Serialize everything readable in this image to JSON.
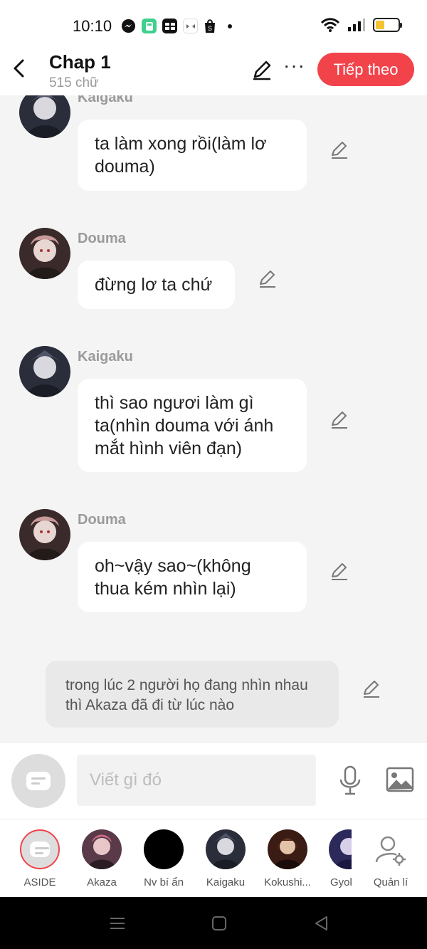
{
  "status_bar": {
    "time": "10:10",
    "app_icons": [
      "messenger-icon",
      "calculator-icon",
      "baomoi-icon",
      "game-icon",
      "shopee-icon"
    ]
  },
  "header": {
    "title": "Chap 1",
    "subtitle": "515 chữ",
    "next_label": "Tiếp theo"
  },
  "messages": [
    {
      "sender": "Kaigaku",
      "text": "ta làm xong rồi(làm lơ douma)"
    },
    {
      "sender": "Douma",
      "text": "đừng lơ ta chứ"
    },
    {
      "sender": "Kaigaku",
      "text": "thì sao ngươi làm gì ta(nhìn douma với ánh mắt hình viên đạn)"
    },
    {
      "sender": "Douma",
      "text": "oh~vậy sao~(không thua kém nhìn lại)"
    }
  ],
  "narration": "trong lúc 2 người họ đang nhìn nhau thì Akaza đã đi từ lúc nào",
  "composer": {
    "placeholder": "Viết gì đó"
  },
  "characters": [
    {
      "label": "ASIDE"
    },
    {
      "label": "Akaza"
    },
    {
      "label": "Nv bí ẩn"
    },
    {
      "label": "Kaigaku"
    },
    {
      "label": "Kokushi..."
    },
    {
      "label": "Gyok"
    },
    {
      "label": "Quản lí"
    }
  ],
  "colors": {
    "accent": "#f2434b",
    "bubble": "#ffffff",
    "background": "#f4f4f4"
  }
}
